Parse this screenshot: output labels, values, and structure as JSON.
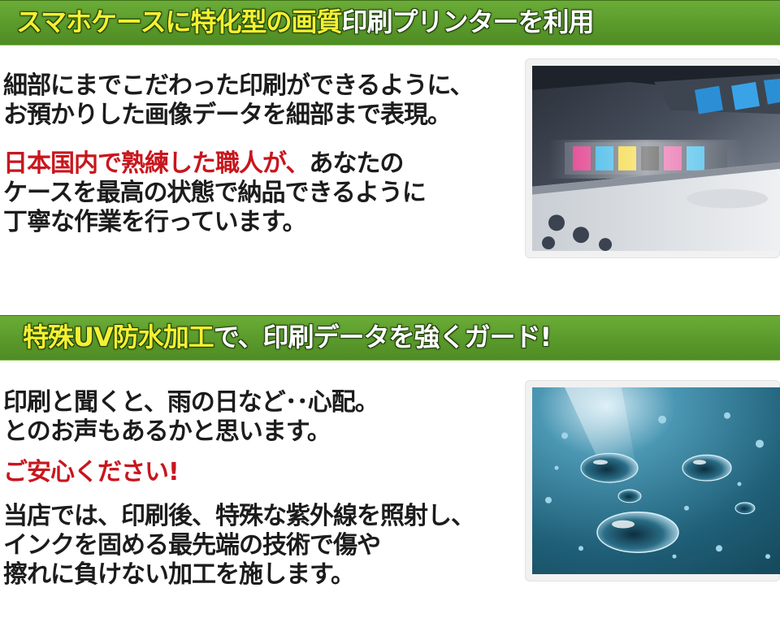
{
  "section1": {
    "banner": {
      "highlight": "スマホケースに特化型の画質",
      "rest": "印刷プリンターを利用"
    },
    "paragraph1": [
      "細部にまでこだわった印刷ができるように、",
      "お預かりした画像データを細部まで表現。"
    ],
    "paragraph2": {
      "red": "日本国内で熟練した職人が、",
      "line1_rest": "あなたの",
      "line2": "ケースを最高の状態で納品できるように",
      "line3": "丁寧な作業を行っています。"
    },
    "image": {
      "subject": "printer-photo"
    }
  },
  "section2": {
    "banner": {
      "highlight": "特殊UV防水加工",
      "rest": "で、印刷データを強くガード!"
    },
    "paragraph1": [
      "印刷と聞くと、雨の日など･･心配。",
      "とのお声もあるかと思います。"
    ],
    "paragraph2": "ご安心ください!",
    "paragraph3": [
      "当店では、印刷後、特殊な紫外線を照射し、",
      "インクを固める最先端の技術で傷や",
      "擦れに負けない加工を施します。"
    ],
    "image": {
      "subject": "water-droplets-photo"
    }
  },
  "colors": {
    "banner_green": "#5a9a2b",
    "banner_highlight": "#f4f032",
    "accent_red": "#c8161d",
    "body_text": "#1c1c1c"
  }
}
